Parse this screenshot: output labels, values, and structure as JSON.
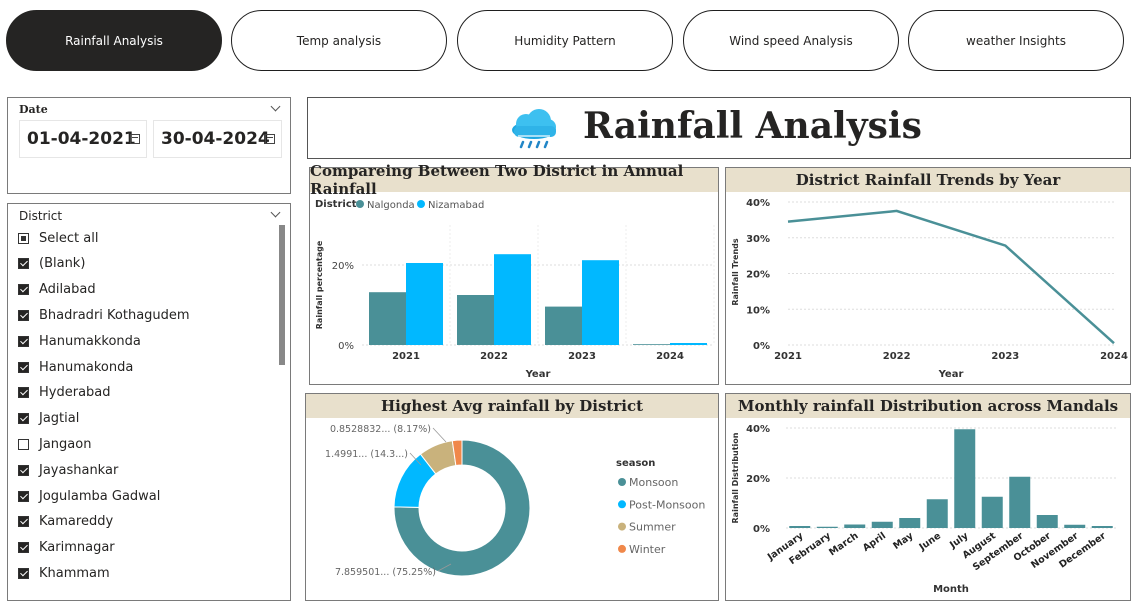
{
  "tabs": [
    {
      "label": "Rainfall Analysis",
      "active": true
    },
    {
      "label": "Temp analysis",
      "active": false
    },
    {
      "label": "Humidity Pattern",
      "active": false
    },
    {
      "label": "Wind speed Analysis",
      "active": false
    },
    {
      "label": "weather Insights",
      "active": false
    }
  ],
  "date_slicer": {
    "title": "Date",
    "start": "01-04-2021",
    "end": "30-04-2024"
  },
  "district_slicer": {
    "title": "District",
    "items": [
      {
        "label": "Select all",
        "state": "partial"
      },
      {
        "label": "(Blank)",
        "state": "checked"
      },
      {
        "label": "Adilabad",
        "state": "checked"
      },
      {
        "label": "Bhadradri Kothagudem",
        "state": "checked"
      },
      {
        "label": "Hanumakkonda",
        "state": "checked"
      },
      {
        "label": "Hanumakonda",
        "state": "checked"
      },
      {
        "label": "Hyderabad",
        "state": "checked"
      },
      {
        "label": "Jagtial",
        "state": "checked"
      },
      {
        "label": "Jangaon",
        "state": "unchecked"
      },
      {
        "label": "Jayashankar",
        "state": "checked"
      },
      {
        "label": "Jogulamba Gadwal",
        "state": "checked"
      },
      {
        "label": "Kamareddy",
        "state": "checked"
      },
      {
        "label": "Karimnagar",
        "state": "checked"
      },
      {
        "label": "Khammam",
        "state": "checked"
      }
    ]
  },
  "page_title": "Rainfall Analysis",
  "colors": {
    "teal": "#4a9097",
    "blue": "#01b8ff",
    "tan": "#c9b27c",
    "orange": "#f0884a",
    "line": "#4a9097"
  },
  "chart_data": [
    {
      "type": "bar",
      "title": "Compareing Between Two District in Annual Rainfall",
      "legend_title": "District",
      "categories": [
        "2021",
        "2022",
        "2023",
        "2024"
      ],
      "series": [
        {
          "name": "Nalgonda",
          "values": [
            13.2,
            12.5,
            9.6,
            0.2
          ]
        },
        {
          "name": "Nizamabad",
          "values": [
            20.5,
            22.7,
            21.2,
            0.5
          ]
        }
      ],
      "xlabel": "Year",
      "ylabel": "Rainfall percentage",
      "yticks": [
        "0%",
        "20%"
      ],
      "ylim": [
        0,
        30
      ]
    },
    {
      "type": "line",
      "title": "District Rainfall Trends by Year",
      "x": [
        "2021",
        "2022",
        "2023",
        "2024"
      ],
      "values": [
        34.5,
        37.5,
        27.8,
        0.5
      ],
      "xlabel": "Year",
      "ylabel": "Rainfall Trends",
      "yticks": [
        "0%",
        "10%",
        "20%",
        "30%",
        "40%"
      ],
      "ylim": [
        0,
        40
      ]
    },
    {
      "type": "pie",
      "title": "Highest Avg rainfall by District",
      "legend_title": "season",
      "slices": [
        {
          "name": "Monsoon",
          "value": 75.25,
          "label": "7.859501... (75.25%)"
        },
        {
          "name": "Post-Monsoon",
          "value": 14.3,
          "label": "1.4991... (14.3...)"
        },
        {
          "name": "Summer",
          "value": 8.17,
          "label": "0.8528832... (8.17%)"
        },
        {
          "name": "Winter",
          "value": 2.28,
          "label": ""
        }
      ]
    },
    {
      "type": "bar",
      "title": "Monthly rainfall Distribution across Mandals",
      "categories": [
        "January",
        "February",
        "March",
        "April",
        "May",
        "June",
        "July",
        "August",
        "September",
        "October",
        "November",
        "December"
      ],
      "values": [
        0.8,
        0.5,
        1.4,
        2.5,
        4.0,
        11.5,
        39.5,
        12.5,
        20.5,
        5.2,
        1.3,
        0.8
      ],
      "xlabel": "Month",
      "ylabel": "Rainfall Distribution",
      "yticks": [
        "0%",
        "20%",
        "40%"
      ],
      "ylim": [
        0,
        40
      ]
    }
  ]
}
